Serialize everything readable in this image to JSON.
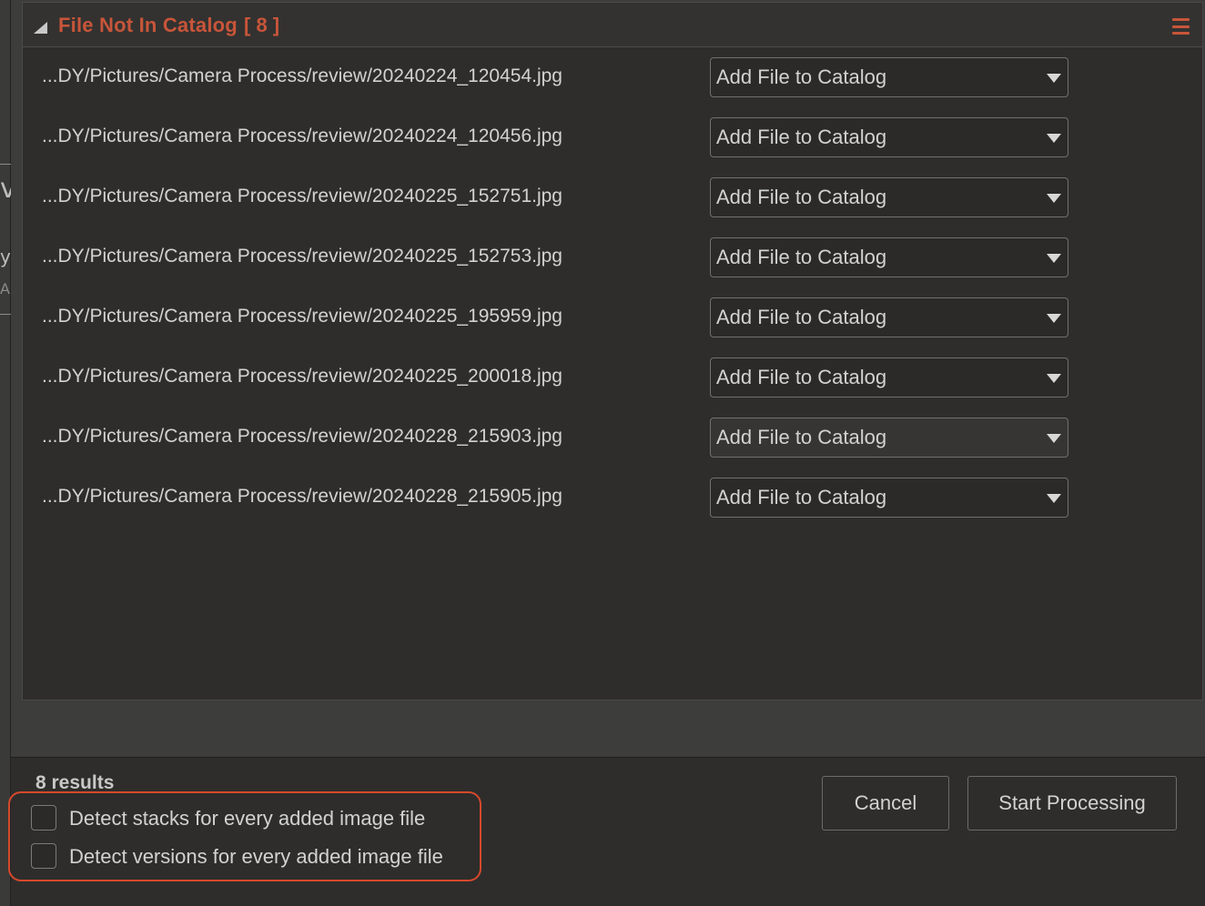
{
  "panel": {
    "title": "File Not In Catalog",
    "count": "[ 8 ]"
  },
  "rows": [
    {
      "path": "...DY/Pictures/Camera Process/review/20240224_120454.jpg",
      "action": "Add File to Catalog"
    },
    {
      "path": "...DY/Pictures/Camera Process/review/20240224_120456.jpg",
      "action": "Add File to Catalog"
    },
    {
      "path": "...DY/Pictures/Camera Process/review/20240225_152751.jpg",
      "action": "Add File to Catalog"
    },
    {
      "path": "...DY/Pictures/Camera Process/review/20240225_152753.jpg",
      "action": "Add File to Catalog"
    },
    {
      "path": "...DY/Pictures/Camera Process/review/20240225_195959.jpg",
      "action": "Add File to Catalog"
    },
    {
      "path": "...DY/Pictures/Camera Process/review/20240225_200018.jpg",
      "action": "Add File to Catalog"
    },
    {
      "path": "...DY/Pictures/Camera Process/review/20240228_215903.jpg",
      "action": "Add File to Catalog"
    },
    {
      "path": "...DY/Pictures/Camera Process/review/20240228_215905.jpg",
      "action": "Add File to Catalog"
    }
  ],
  "footer": {
    "results": "8 results",
    "detect_stacks_label": "Detect stacks for every added image file",
    "detect_versions_label": "Detect versions for every added image file",
    "detect_stacks_checked": false,
    "detect_versions_checked": false,
    "cancel_label": "Cancel",
    "start_label": "Start Processing"
  },
  "background_fragments": {
    "frag1": "vi",
    "frag2": "y",
    "frag3": "A"
  },
  "colors": {
    "accent": "#c8553a",
    "highlight": "#d5492c",
    "panel_bg": "#2e2d2b"
  }
}
